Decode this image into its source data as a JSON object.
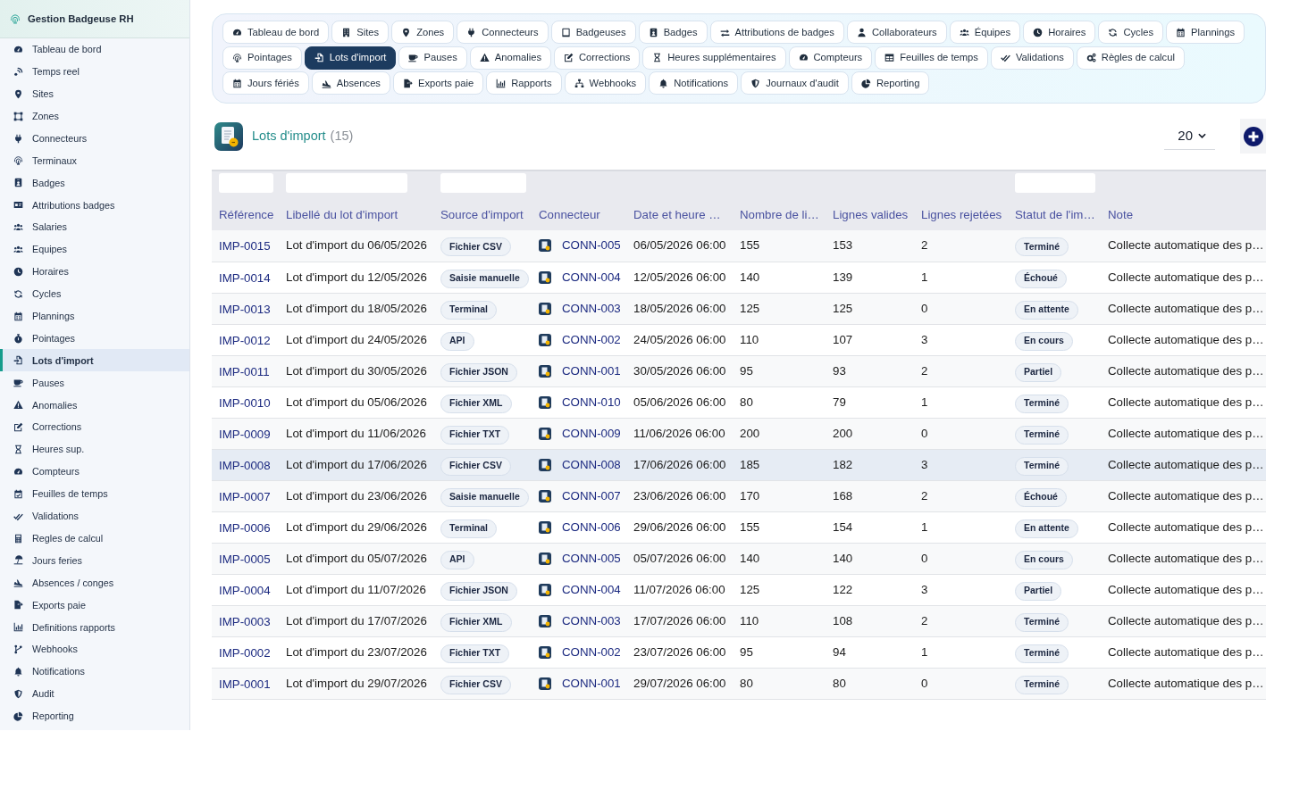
{
  "sidebar": {
    "title": "Gestion Badgeuse RH",
    "items": [
      {
        "label": "Tableau de bord",
        "selected": false
      },
      {
        "label": "Temps reel",
        "selected": false
      },
      {
        "label": "Sites",
        "selected": false
      },
      {
        "label": "Zones",
        "selected": false
      },
      {
        "label": "Connecteurs",
        "selected": false
      },
      {
        "label": "Terminaux",
        "selected": false
      },
      {
        "label": "Badges",
        "selected": false
      },
      {
        "label": "Attributions badges",
        "selected": false
      },
      {
        "label": "Salaries",
        "selected": false
      },
      {
        "label": "Equipes",
        "selected": false
      },
      {
        "label": "Horaires",
        "selected": false
      },
      {
        "label": "Cycles",
        "selected": false
      },
      {
        "label": "Plannings",
        "selected": false
      },
      {
        "label": "Pointages",
        "selected": false
      },
      {
        "label": "Lots d'import",
        "selected": true
      },
      {
        "label": "Pauses",
        "selected": false
      },
      {
        "label": "Anomalies",
        "selected": false
      },
      {
        "label": "Corrections",
        "selected": false
      },
      {
        "label": "Heures sup.",
        "selected": false
      },
      {
        "label": "Compteurs",
        "selected": false
      },
      {
        "label": "Feuilles de temps",
        "selected": false
      },
      {
        "label": "Validations",
        "selected": false
      },
      {
        "label": "Regles de calcul",
        "selected": false
      },
      {
        "label": "Jours feries",
        "selected": false
      },
      {
        "label": "Absences / conges",
        "selected": false
      },
      {
        "label": "Exports paie",
        "selected": false
      },
      {
        "label": "Definitions rapports",
        "selected": false
      },
      {
        "label": "Webhooks",
        "selected": false
      },
      {
        "label": "Notifications",
        "selected": false
      },
      {
        "label": "Audit",
        "selected": false
      },
      {
        "label": "Reporting",
        "selected": false
      }
    ]
  },
  "nav_tabs": {
    "rows": [
      {
        "tabs": [
          {
            "label": "Tableau de bord",
            "selected": false
          },
          {
            "label": "Sites",
            "selected": false
          },
          {
            "label": "Zones",
            "selected": false
          },
          {
            "label": "Connecteurs",
            "selected": false
          },
          {
            "label": "Badgeuses",
            "selected": false
          },
          {
            "label": "Badges",
            "selected": false
          },
          {
            "label": "Attributions de badges",
            "selected": false
          },
          {
            "label": "Collaborateurs",
            "selected": false
          },
          {
            "label": "Équipes",
            "selected": false
          },
          {
            "label": "Horaires",
            "selected": false
          },
          {
            "label": "Cycles",
            "selected": false
          },
          {
            "label": "Plannings",
            "selected": false
          }
        ]
      },
      {
        "tabs": [
          {
            "label": "Pointages",
            "selected": false
          },
          {
            "label": "Lots d'import",
            "selected": true
          },
          {
            "label": "Pauses",
            "selected": false
          },
          {
            "label": "Anomalies",
            "selected": false
          },
          {
            "label": "Corrections",
            "selected": false
          },
          {
            "label": "Heures supplémentaires",
            "selected": false
          },
          {
            "label": "Compteurs",
            "selected": false
          },
          {
            "label": "Feuilles de temps",
            "selected": false
          },
          {
            "label": "Validations",
            "selected": false
          },
          {
            "label": "Règles de calcul",
            "selected": false
          }
        ]
      },
      {
        "tabs": [
          {
            "label": "Jours fériés",
            "selected": false
          },
          {
            "label": "Absences",
            "selected": false
          },
          {
            "label": "Exports paie",
            "selected": false
          },
          {
            "label": "Rapports",
            "selected": false
          },
          {
            "label": "Webhooks",
            "selected": false
          },
          {
            "label": "Notifications",
            "selected": false
          },
          {
            "label": "Journaux d'audit",
            "selected": false
          },
          {
            "label": "Reporting",
            "selected": false
          }
        ]
      }
    ]
  },
  "header": {
    "title": "Lots d'import",
    "count": "(15)",
    "page_size": "20"
  },
  "table": {
    "columns": [
      {
        "label": "Référence",
        "kind": "link",
        "filter": true
      },
      {
        "label": "Libellé du lot d'import",
        "kind": "text",
        "filter": true
      },
      {
        "label": "Source d'import",
        "kind": "badge",
        "filter": true
      },
      {
        "label": "Connecteur",
        "kind": "connector",
        "filter": false
      },
      {
        "label": "Date et heure …",
        "kind": "text",
        "filter": false
      },
      {
        "label": "Nombre de li…",
        "kind": "text",
        "filter": false
      },
      {
        "label": "Lignes valides",
        "kind": "text",
        "filter": false
      },
      {
        "label": "Lignes rejetées",
        "kind": "text",
        "filter": false
      },
      {
        "label": "Statut de l'im…",
        "kind": "badge",
        "filter": true
      },
      {
        "label": "Note",
        "kind": "text",
        "filter": false
      }
    ],
    "rows": [
      {
        "selected": false,
        "cells": [
          "IMP-0015",
          "Lot d'import du 06/05/2026",
          "Fichier CSV",
          "CONN-005",
          "06/05/2026 06:00",
          "155",
          "153",
          "2",
          "Terminé",
          "Collecte automatique des p…"
        ]
      },
      {
        "selected": false,
        "cells": [
          "IMP-0014",
          "Lot d'import du 12/05/2026",
          "Saisie manuelle",
          "CONN-004",
          "12/05/2026 06:00",
          "140",
          "139",
          "1",
          "Échoué",
          "Collecte automatique des p…"
        ]
      },
      {
        "selected": false,
        "cells": [
          "IMP-0013",
          "Lot d'import du 18/05/2026",
          "Terminal",
          "CONN-003",
          "18/05/2026 06:00",
          "125",
          "125",
          "0",
          "En attente",
          "Collecte automatique des p…"
        ]
      },
      {
        "selected": false,
        "cells": [
          "IMP-0012",
          "Lot d'import du 24/05/2026",
          "API",
          "CONN-002",
          "24/05/2026 06:00",
          "110",
          "107",
          "3",
          "En cours",
          "Collecte automatique des p…"
        ]
      },
      {
        "selected": false,
        "cells": [
          "IMP-0011",
          "Lot d'import du 30/05/2026",
          "Fichier JSON",
          "CONN-001",
          "30/05/2026 06:00",
          "95",
          "93",
          "2",
          "Partiel",
          "Collecte automatique des p…"
        ]
      },
      {
        "selected": false,
        "cells": [
          "IMP-0010",
          "Lot d'import du 05/06/2026",
          "Fichier XML",
          "CONN-010",
          "05/06/2026 06:00",
          "80",
          "79",
          "1",
          "Terminé",
          "Collecte automatique des p…"
        ]
      },
      {
        "selected": false,
        "cells": [
          "IMP-0009",
          "Lot d'import du 11/06/2026",
          "Fichier TXT",
          "CONN-009",
          "11/06/2026 06:00",
          "200",
          "200",
          "0",
          "Terminé",
          "Collecte automatique des p…"
        ]
      },
      {
        "selected": true,
        "cells": [
          "IMP-0008",
          "Lot d'import du 17/06/2026",
          "Fichier CSV",
          "CONN-008",
          "17/06/2026 06:00",
          "185",
          "182",
          "3",
          "Terminé",
          "Collecte automatique des p…"
        ]
      },
      {
        "selected": false,
        "cells": [
          "IMP-0007",
          "Lot d'import du 23/06/2026",
          "Saisie manuelle",
          "CONN-007",
          "23/06/2026 06:00",
          "170",
          "168",
          "2",
          "Échoué",
          "Collecte automatique des p…"
        ]
      },
      {
        "selected": false,
        "cells": [
          "IMP-0006",
          "Lot d'import du 29/06/2026",
          "Terminal",
          "CONN-006",
          "29/06/2026 06:00",
          "155",
          "154",
          "1",
          "En attente",
          "Collecte automatique des p…"
        ]
      },
      {
        "selected": false,
        "cells": [
          "IMP-0005",
          "Lot d'import du 05/07/2026",
          "API",
          "CONN-005",
          "05/07/2026 06:00",
          "140",
          "140",
          "0",
          "En cours",
          "Collecte automatique des p…"
        ]
      },
      {
        "selected": false,
        "cells": [
          "IMP-0004",
          "Lot d'import du 11/07/2026",
          "Fichier JSON",
          "CONN-004",
          "11/07/2026 06:00",
          "125",
          "122",
          "3",
          "Partiel",
          "Collecte automatique des p…"
        ]
      },
      {
        "selected": false,
        "cells": [
          "IMP-0003",
          "Lot d'import du 17/07/2026",
          "Fichier XML",
          "CONN-003",
          "17/07/2026 06:00",
          "110",
          "108",
          "2",
          "Terminé",
          "Collecte automatique des p…"
        ]
      },
      {
        "selected": false,
        "cells": [
          "IMP-0002",
          "Lot d'import du 23/07/2026",
          "Fichier TXT",
          "CONN-002",
          "23/07/2026 06:00",
          "95",
          "94",
          "1",
          "Terminé",
          "Collecte automatique des p…"
        ]
      },
      {
        "selected": false,
        "cells": [
          "IMP-0001",
          "Lot d'import du 29/07/2026",
          "Fichier CSV",
          "CONN-001",
          "29/07/2026 06:00",
          "80",
          "80",
          "0",
          "Terminé",
          "Collecte automatique des p…"
        ]
      }
    ]
  }
}
